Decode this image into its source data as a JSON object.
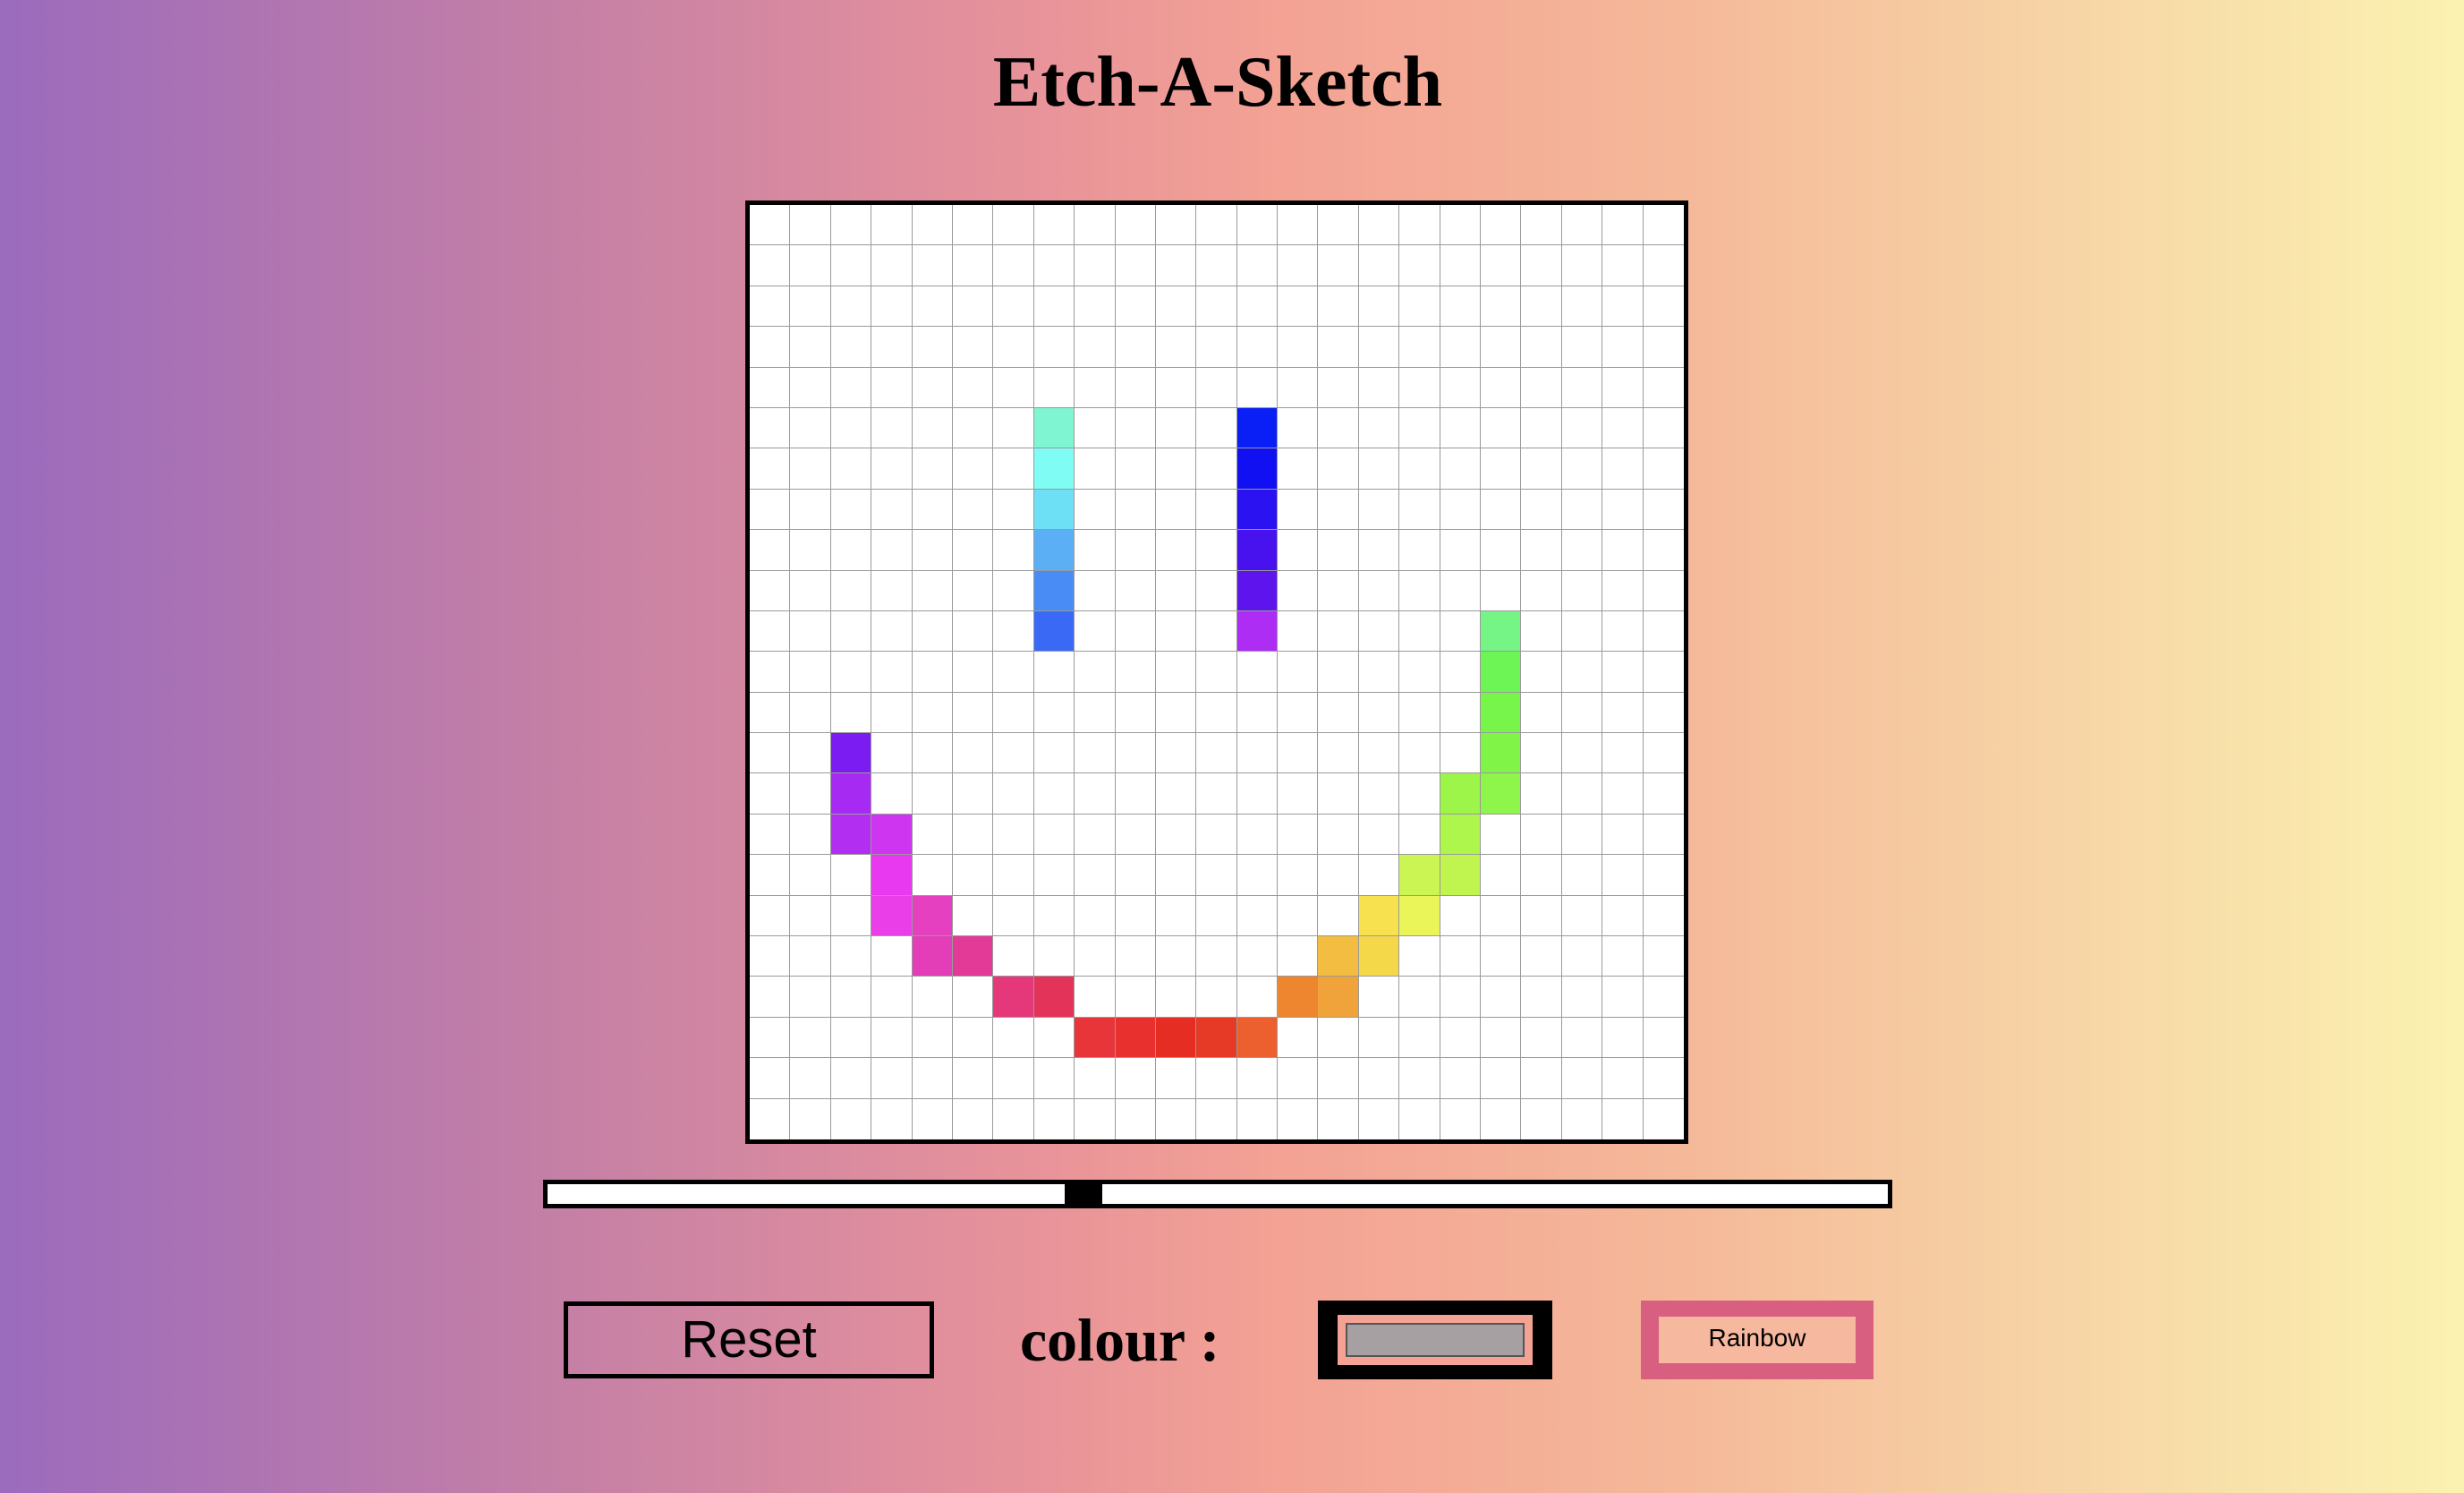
{
  "header": {
    "title": "Etch-A-Sketch"
  },
  "grid": {
    "size": 23,
    "cell_color": "#ffffff",
    "line_color": "#9a9a9a",
    "painted": [
      {
        "r": 5,
        "c": 7,
        "color": "#7ff5d2"
      },
      {
        "r": 6,
        "c": 7,
        "color": "#7ffdf5"
      },
      {
        "r": 7,
        "c": 7,
        "color": "#6ee0f5"
      },
      {
        "r": 8,
        "c": 7,
        "color": "#5aaff5"
      },
      {
        "r": 9,
        "c": 7,
        "color": "#4a8cf5"
      },
      {
        "r": 10,
        "c": 7,
        "color": "#3a6af5"
      },
      {
        "r": 5,
        "c": 12,
        "color": "#0a1ff5"
      },
      {
        "r": 6,
        "c": 12,
        "color": "#1010f3"
      },
      {
        "r": 7,
        "c": 12,
        "color": "#2b12f0"
      },
      {
        "r": 8,
        "c": 12,
        "color": "#4712ee"
      },
      {
        "r": 9,
        "c": 12,
        "color": "#5e14ec"
      },
      {
        "r": 10,
        "c": 12,
        "color": "#ad2df5"
      },
      {
        "r": 13,
        "c": 2,
        "color": "#7a1cf2"
      },
      {
        "r": 14,
        "c": 2,
        "color": "#a62af2"
      },
      {
        "r": 15,
        "c": 2,
        "color": "#b22ff2"
      },
      {
        "r": 15,
        "c": 3,
        "color": "#cd35f0"
      },
      {
        "r": 16,
        "c": 3,
        "color": "#e838f0"
      },
      {
        "r": 17,
        "c": 3,
        "color": "#ea3ee8"
      },
      {
        "r": 17,
        "c": 4,
        "color": "#e540c0"
      },
      {
        "r": 18,
        "c": 4,
        "color": "#e43db8"
      },
      {
        "r": 18,
        "c": 5,
        "color": "#e33a98"
      },
      {
        "r": 19,
        "c": 6,
        "color": "#e4387a"
      },
      {
        "r": 19,
        "c": 7,
        "color": "#e43358"
      },
      {
        "r": 20,
        "c": 8,
        "color": "#e8353a"
      },
      {
        "r": 20,
        "c": 9,
        "color": "#e8302e"
      },
      {
        "r": 20,
        "c": 10,
        "color": "#e62d24"
      },
      {
        "r": 20,
        "c": 11,
        "color": "#e63a26"
      },
      {
        "r": 20,
        "c": 12,
        "color": "#ec5f2e"
      },
      {
        "r": 19,
        "c": 13,
        "color": "#ee8630"
      },
      {
        "r": 19,
        "c": 14,
        "color": "#f0a33a"
      },
      {
        "r": 18,
        "c": 14,
        "color": "#f2bd40"
      },
      {
        "r": 18,
        "c": 15,
        "color": "#f5d84a"
      },
      {
        "r": 17,
        "c": 15,
        "color": "#f8e14e"
      },
      {
        "r": 17,
        "c": 16,
        "color": "#eaf55a"
      },
      {
        "r": 16,
        "c": 16,
        "color": "#cbf552"
      },
      {
        "r": 16,
        "c": 17,
        "color": "#bff54e"
      },
      {
        "r": 15,
        "c": 17,
        "color": "#aef54c"
      },
      {
        "r": 14,
        "c": 17,
        "color": "#9ef54a"
      },
      {
        "r": 14,
        "c": 18,
        "color": "#8ef54a"
      },
      {
        "r": 13,
        "c": 18,
        "color": "#80f548"
      },
      {
        "r": 12,
        "c": 18,
        "color": "#78f54a"
      },
      {
        "r": 11,
        "c": 18,
        "color": "#6df555"
      },
      {
        "r": 10,
        "c": 18,
        "color": "#74f585"
      }
    ]
  },
  "slider": {
    "value": 40,
    "min": 0,
    "max": 100
  },
  "controls": {
    "reset_label": "Reset",
    "colour_label": "colour :",
    "colour_value": "#a6a0a3",
    "rainbow_label": "Rainbow"
  }
}
